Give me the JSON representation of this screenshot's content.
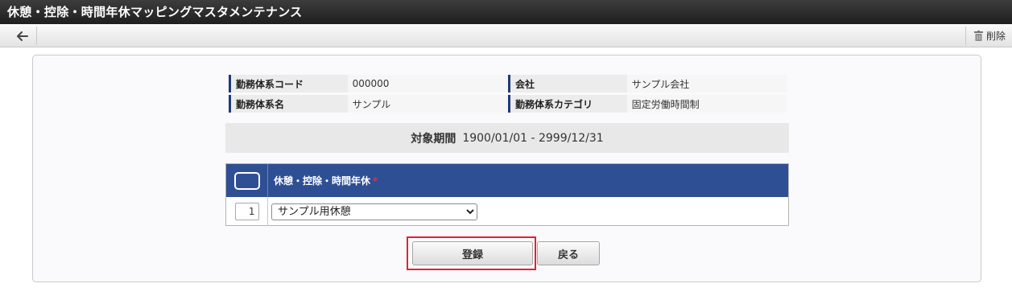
{
  "window": {
    "title": "休憩・控除・時間年休マッピングマスタメンテナンス"
  },
  "toolbar": {
    "back_icon": "arrow-left-icon",
    "delete_label": "削除",
    "delete_icon": "trash-icon"
  },
  "info": {
    "row1": {
      "label_a": "勤務体系コード",
      "value_a": "000000",
      "label_b": "会社",
      "value_b": "サンプル会社"
    },
    "row2": {
      "label_a": "勤務体系名",
      "value_a": "サンプル",
      "label_b": "勤務体系カテゴリ",
      "value_b": "固定労働時間制"
    }
  },
  "period": {
    "label": "対象期間",
    "value": "1900/01/01 - 2999/12/31"
  },
  "grid": {
    "column_title": "休憩・控除・時間年休",
    "required_mark": "*",
    "rows": [
      {
        "number": "1",
        "selected": "サンプル用休憩"
      }
    ]
  },
  "buttons": {
    "register": "登録",
    "back": "戻る"
  },
  "colors": {
    "title_bar": "#2a2a2a",
    "grid_header": "#2f4f95",
    "label_accent": "#1f3a78",
    "highlight": "#e0242e"
  }
}
